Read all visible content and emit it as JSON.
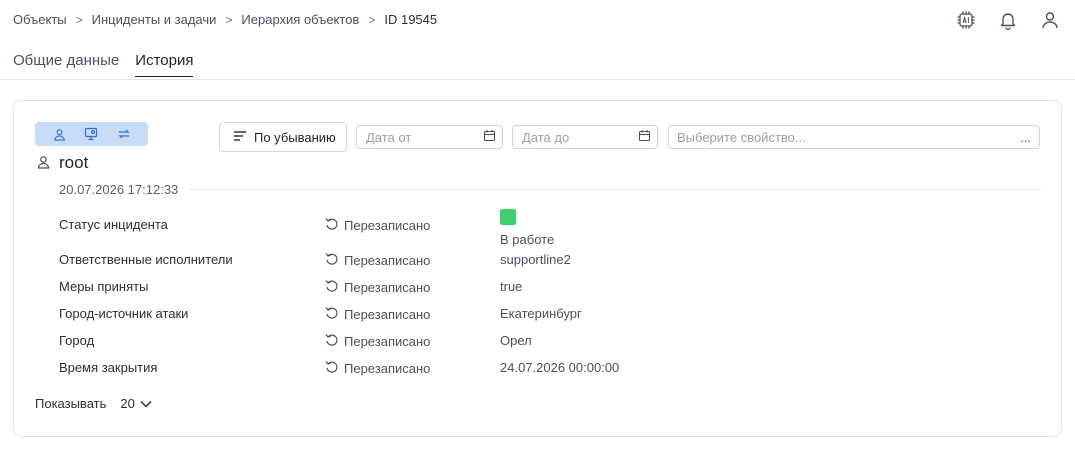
{
  "breadcrumb": {
    "items": [
      "Объекты",
      "Инциденты и задачи",
      "Иерархия объектов"
    ],
    "current": "ID 19545",
    "separator": ">"
  },
  "top_icons": [
    "ai-chip-icon",
    "bell-icon",
    "user-icon"
  ],
  "tabs": [
    {
      "label": "Общие данные",
      "active": false
    },
    {
      "label": "История",
      "active": true
    }
  ],
  "filters": {
    "toggles": [
      "user-icon",
      "monitor-icon",
      "exchange-icon"
    ],
    "sort_label": "По убыванию",
    "date_from_placeholder": "Дата от",
    "date_to_placeholder": "Дата до",
    "property_placeholder": "Выберите свойство...",
    "property_more": "..."
  },
  "entry": {
    "user": "root",
    "timestamp": "20.07.2026 17:12:33",
    "status_color": "#3ecf6e",
    "changes": [
      {
        "property": "Статус инцидента",
        "action": "Перезаписано",
        "value": "В работе"
      },
      {
        "property": "Ответственные исполнители",
        "action": "Перезаписано",
        "value": "supportline2"
      },
      {
        "property": "Меры приняты",
        "action": "Перезаписано",
        "value": "true"
      },
      {
        "property": "Город-источник атаки",
        "action": "Перезаписано",
        "value": "Екатеринбург"
      },
      {
        "property": "Город",
        "action": "Перезаписано",
        "value": "Орел"
      },
      {
        "property": "Время закрытия",
        "action": "Перезаписано",
        "value": "24.07.2026 00:00:00"
      }
    ]
  },
  "pager": {
    "label": "Показывать",
    "count": "20"
  },
  "colors": {
    "accent_toggle_bg": "#c9dcf7",
    "accent_icon": "#2f6fd6"
  }
}
